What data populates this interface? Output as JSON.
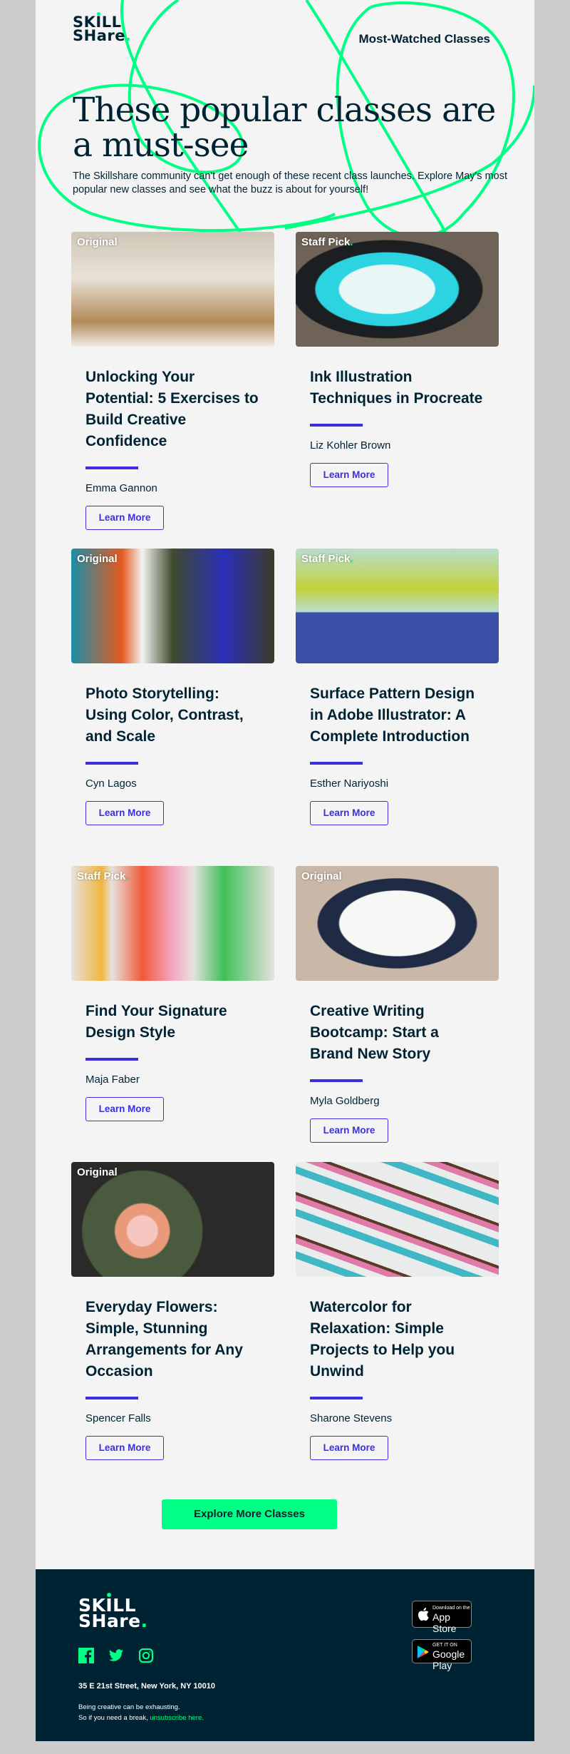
{
  "header": {
    "logo_line1": "SKILL",
    "logo_line2": "SHare",
    "logo_dot": ".",
    "nav_title": "Most-Watched Classes"
  },
  "hero": {
    "title": "These popular classes are a must-see",
    "subtitle": "The Skillshare community can't get enough of these recent class launches. Explore May's most popular new classes and see what the buzz is about for yourself!"
  },
  "colors": {
    "accent_green": "#00ff84",
    "accent_purple": "#3d2ee0",
    "navy": "#002333",
    "page_bg": "#f4f4f4",
    "outer_bg": "#cccccc"
  },
  "classes": [
    {
      "badge": "Original",
      "title": "Unlocking Your Potential: 5 Exercises to Build Creative Confidence",
      "author": "Emma Gannon",
      "button": "Learn More",
      "image": "woman-yellow-shirt-laughing"
    },
    {
      "badge": "Staff Pick",
      "title": "Ink Illustration Techniques in Procreate",
      "author": "Liz Kohler Brown",
      "button": "Learn More",
      "image": "tablet-plant-illustration"
    },
    {
      "badge": "Original",
      "title": "Photo Storytelling: Using Color, Contrast, and Scale",
      "author": "Cyn Lagos",
      "button": "Learn More",
      "image": "photos-and-woman-smiling"
    },
    {
      "badge": "Staff Pick",
      "title": "Surface Pattern Design in Adobe Illustrator: A Complete Introduction",
      "author": "Esther Nariyoshi",
      "button": "Learn More",
      "image": "pattern-with-pen-tool"
    },
    {
      "badge": "Staff Pick",
      "title": "Find Your Signature Design Style",
      "author": "Maja Faber",
      "button": "Learn More",
      "image": "hanging-pattern-prints"
    },
    {
      "badge": "Original",
      "title": "Creative Writing Bootcamp: Start a Brand New Story",
      "author": "Myla Goldberg",
      "button": "Learn More",
      "image": "venn-diagram-drawing"
    },
    {
      "badge": "Original",
      "title": "Everyday Flowers: Simple, Stunning Arrangements for Any Occasion",
      "author": "Spencer Falls",
      "button": "Learn More",
      "image": "florist-bouquet"
    },
    {
      "badge": "",
      "title": "Watercolor for Relaxation: Simple Projects to Help you Unwind",
      "author": "Sharone Stevens",
      "button": "Learn More",
      "image": "watercolor-swatches"
    }
  ],
  "cta": {
    "label": "Explore More Classes"
  },
  "footer": {
    "logo_line1": "SKILL",
    "logo_line2": "SHare",
    "logo_dot": ".",
    "social": [
      "facebook-icon",
      "twitter-icon",
      "instagram-icon"
    ],
    "address": "35 E 21st Street, New York, NY 10010",
    "note_line1": "Being creative can be exhausting.",
    "note_line2_prefix": "So if you need a break, ",
    "unsubscribe": "unsubscribe here.",
    "app_store_small": "Download on the",
    "app_store_big": "App Store",
    "google_small": "GET IT ON",
    "google_big": "Google Play"
  }
}
